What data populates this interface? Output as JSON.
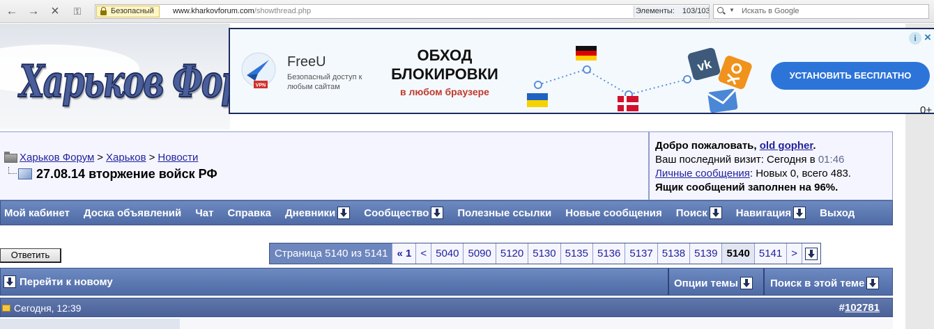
{
  "browser": {
    "secure_label": "Безопасный",
    "url_domain": "www.kharkovforum.com",
    "url_path": "/showthread.php",
    "elements_label": "Элементы:",
    "elements_value": "103/103",
    "search_placeholder": "Искать в Google"
  },
  "logo": {
    "text": "Харьков Форум"
  },
  "ad": {
    "brand": "FreeU",
    "vpn_badge": "VPN",
    "tagline": "Безопасный доступ к любым сайтам",
    "headline_line1": "ОБХОД",
    "headline_line2": "БЛОКИРОВКИ",
    "subline": "в любом браузере",
    "install_button": "УСТАНОВИТЬ БЕСПЛАТНО",
    "info": "i",
    "close": "×",
    "more": "0+",
    "social_vk": "vk",
    "colors": {
      "accent": "#2d74d9",
      "subline": "#c0392b"
    }
  },
  "breadcrumb": {
    "items": [
      "Харьков Форум",
      "Харьков",
      "Новости"
    ],
    "separator": ">",
    "thread_title": "27.08.14 вторжение войск РФ"
  },
  "user": {
    "welcome_prefix": "Добро пожаловать, ",
    "username": "old gopher",
    "welcome_suffix": ".",
    "last_visit_label": "Ваш последний визит: Сегодня в ",
    "last_visit_time": "01:46",
    "pm_link": "Личные сообщения",
    "pm_counts": ": Новых 0, всего 483.",
    "inbox_warning": "Ящик сообщений заполнен на 96%."
  },
  "navbar": {
    "items": [
      "Мой кабинет",
      "Доска объявлений",
      "Чат",
      "Справка",
      "Дневники",
      "Сообщество",
      "Полезные ссылки",
      "Новые сообщения",
      "Поиск",
      "Навигация",
      "Выход"
    ]
  },
  "reply_button": "Ответить",
  "pagination": {
    "label": "Страница 5140 из 5141",
    "first": "« 1",
    "prev": "<",
    "pages": [
      "5040",
      "5090",
      "5120",
      "5130",
      "5135",
      "5136",
      "5137",
      "5138",
      "5139",
      "5140",
      "5141"
    ],
    "current": "5140",
    "next": ">"
  },
  "thread_header": {
    "goto_new": "Перейти к новому",
    "options": "Опции темы",
    "search": "Поиск в этой теме"
  },
  "post": {
    "time": "Сегодня, 12:39",
    "number_prefix": "#",
    "number": "102781"
  },
  "colors": {
    "nav_bar": "#5a76b0",
    "link": "#22229c",
    "box_bg": "#f5f5ff"
  }
}
